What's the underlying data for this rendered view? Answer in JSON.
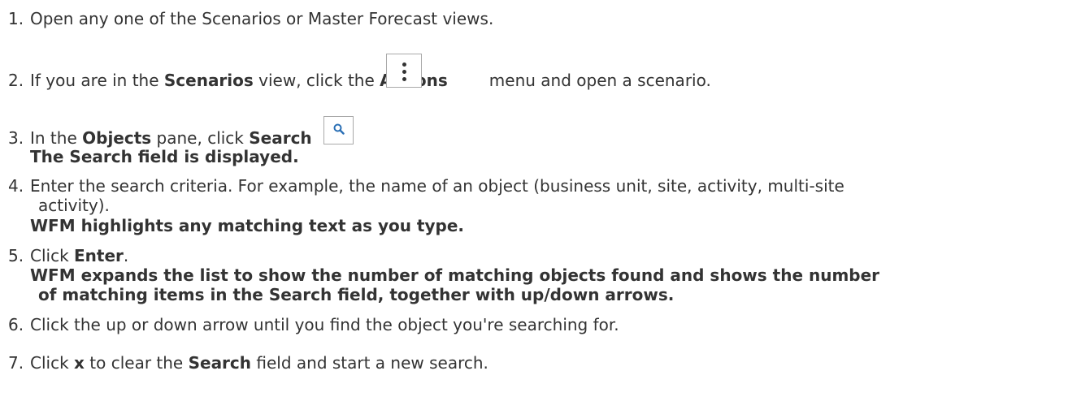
{
  "steps": [
    {
      "number": "1.",
      "segments": [
        {
          "text": "Open any one of the Scenarios or Master Forecast views.",
          "bold": false
        }
      ]
    },
    {
      "number": "2.",
      "segments": [
        {
          "text": "If you are in the ",
          "bold": false
        },
        {
          "text": "Scenarios",
          "bold": true
        },
        {
          "text": " view, click the ",
          "bold": false
        },
        {
          "text": "Actions",
          "bold": true
        },
        {
          "text": "menu and open a scenario.",
          "bold": false
        }
      ],
      "icon": "kebab-menu-icon"
    },
    {
      "number": "3.",
      "segments": [
        {
          "text": "In the ",
          "bold": false
        },
        {
          "text": "Objects",
          "bold": true
        },
        {
          "text": " pane, click ",
          "bold": false
        },
        {
          "text": "Search",
          "bold": true
        },
        {
          "text": ".",
          "bold": false
        }
      ],
      "icon": "search-icon",
      "note": "The Search field is displayed."
    },
    {
      "number": "4.",
      "line1": "Enter the search criteria. For example, the name of an object (business unit, site, activity, multi-site",
      "line2": "activity).",
      "note": "WFM highlights any matching text as you type."
    },
    {
      "number": "5.",
      "segments": [
        {
          "text": "Click ",
          "bold": false
        },
        {
          "text": "Enter",
          "bold": true
        },
        {
          "text": ".",
          "bold": false
        }
      ],
      "note": "WFM expands the list to show the number of matching objects found and shows the number",
      "note_cont": "of matching items in the Search field, together with up/down arrows."
    },
    {
      "number": "6.",
      "segments": [
        {
          "text": "Click the up or down arrow until you find the object you're searching for.",
          "bold": false
        }
      ]
    },
    {
      "number": "7.",
      "segments": [
        {
          "text": "Click ",
          "bold": false
        },
        {
          "text": "x",
          "bold": true
        },
        {
          "text": " to clear the ",
          "bold": false
        },
        {
          "text": "Search",
          "bold": true
        },
        {
          "text": " field and start a new search.",
          "bold": false
        }
      ]
    }
  ],
  "colors": {
    "text": "#333333",
    "icon_border": "#a9a9a9",
    "search_icon": "#2a6fb5"
  }
}
